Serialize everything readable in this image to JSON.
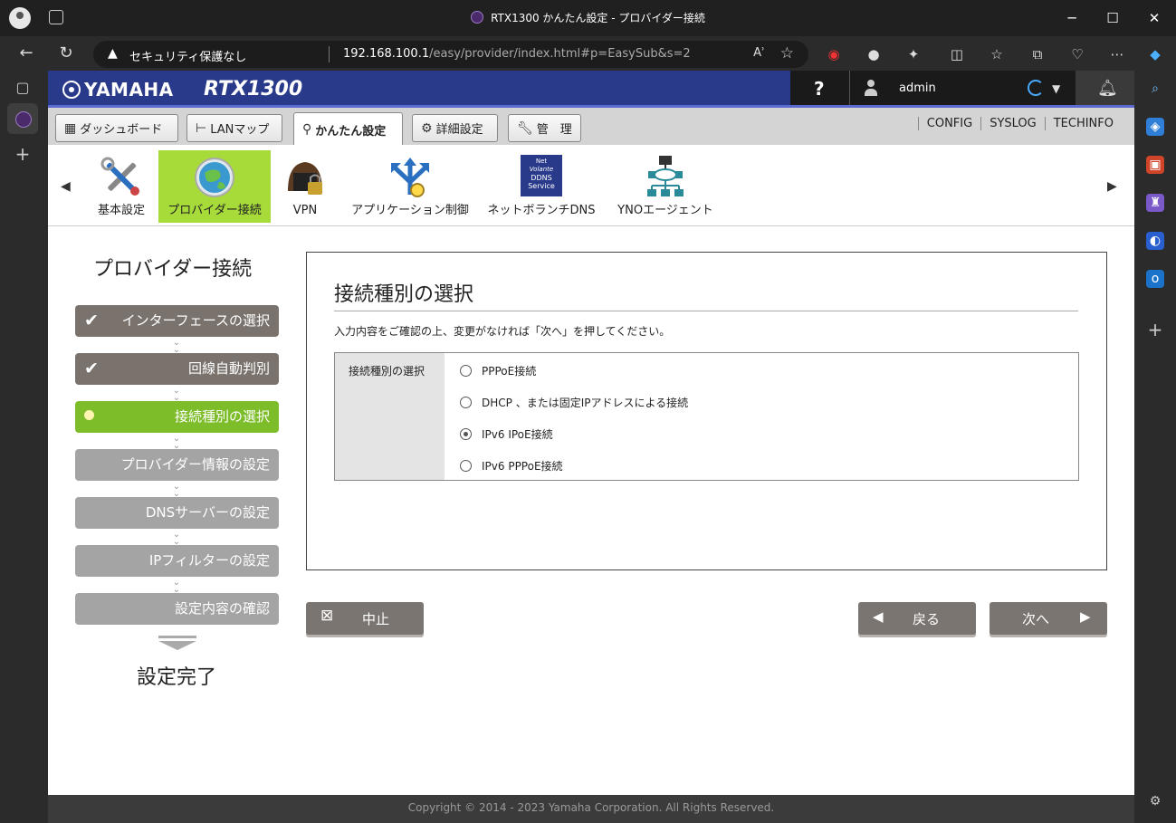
{
  "browser": {
    "tab_title": "RTX1300 かんたん設定 - プロバイダー接続",
    "security_label": "セキュリティ保護なし",
    "url_host": "192.168.100.1",
    "url_path": "/easy/provider/index.html#p=EasySub&s=2",
    "read_aloud": "Aʾ"
  },
  "header": {
    "brand": "YAMAHA",
    "model": "RTX1300",
    "help": "?",
    "user": "admin"
  },
  "tabs": {
    "dashboard": "ダッシュボード",
    "lanmap": "LANマップ",
    "easy": "かんたん設定",
    "detail": "詳細設定",
    "admin": "管　理"
  },
  "toplinks": {
    "config": "CONFIG",
    "syslog": "SYSLOG",
    "techinfo": "TECHINFO"
  },
  "menu": {
    "basic": "基本設定",
    "provider": "プロバイダー接続",
    "vpn": "VPN",
    "app": "アプリケーション制御",
    "netvolante": "ネットボランチDNS",
    "yno": "YNOエージェント",
    "ddns_line1": "Net",
    "ddns_line2": "Volante",
    "ddns_line3": "DDNS",
    "ddns_line4": "Service"
  },
  "steps": {
    "title": "プロバイダー接続",
    "s1": "インターフェースの選択",
    "s2": "回線自動判別",
    "s3": "接続種別の選択",
    "s4": "プロバイダー情報の設定",
    "s5": "DNSサーバーの設定",
    "s6": "IPフィルターの設定",
    "s7": "設定内容の確認",
    "final": "設定完了"
  },
  "form": {
    "heading": "接続種別の選択",
    "instruction": "入力内容をご確認の上、変更がなければ「次へ」を押してください。",
    "field_label": "接続種別の選択",
    "options": [
      {
        "label": "PPPoE接続",
        "selected": false
      },
      {
        "label": "DHCP 、または固定IPアドレスによる接続",
        "selected": false
      },
      {
        "label": "IPv6 IPoE接続",
        "selected": true
      },
      {
        "label": "IPv6 PPPoE接続",
        "selected": false
      }
    ]
  },
  "buttons": {
    "cancel": "中止",
    "back": "戻る",
    "next": "次へ"
  },
  "footer": {
    "copyright": "Copyright © 2014 - 2023 Yamaha Corporation. All Rights Reserved."
  },
  "colors": {
    "header_blue": "#2a3a8a",
    "active_green": "#a6db3a",
    "step_current": "#7dbd2a",
    "step_done": "#7a736d",
    "step_todo": "#a4a4a4"
  }
}
